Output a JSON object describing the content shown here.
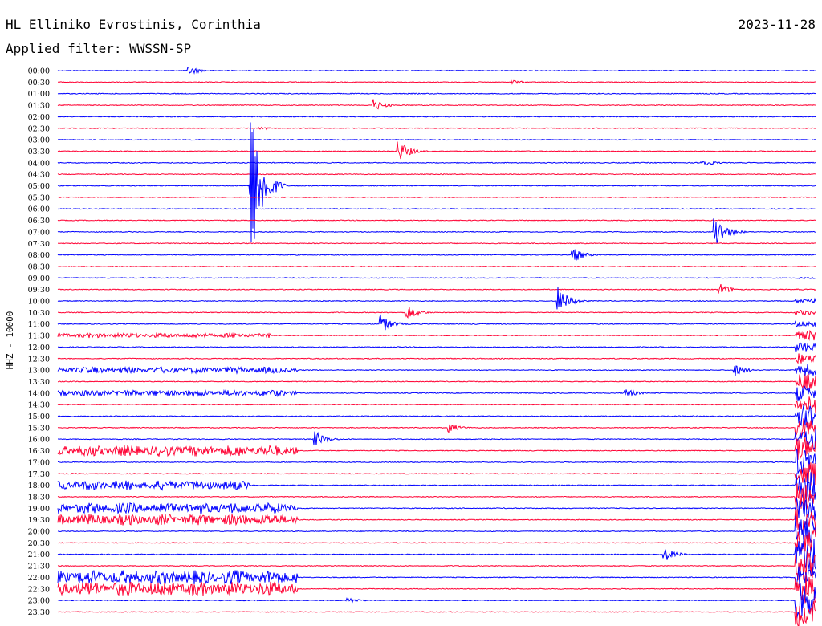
{
  "header": {
    "station": "HL Elliniko Evrostinis, Corinthia",
    "date": "2023-11-28",
    "filter": "Applied filter: WWSSN-SP"
  },
  "colors": {
    "even_trace": "#0000ff",
    "odd_trace": "#ff0033",
    "background": "#ffffff"
  },
  "chart_data": {
    "type": "line",
    "title": "HL Elliniko Evrostinis, Corinthia",
    "subtitle": "Applied filter: WWSSN-SP",
    "ylabel": "HHZ - 10000",
    "xlabel": "",
    "grid": false,
    "legend": "none",
    "row_labels": [
      "00:00",
      "00:30",
      "01:00",
      "01:30",
      "02:00",
      "02:30",
      "03:00",
      "03:30",
      "04:00",
      "04:30",
      "05:00",
      "05:30",
      "06:00",
      "06:30",
      "07:00",
      "07:30",
      "08:00",
      "08:30",
      "09:00",
      "09:30",
      "10:00",
      "10:30",
      "11:00",
      "11:30",
      "12:00",
      "12:30",
      "13:00",
      "13:30",
      "14:00",
      "14:30",
      "15:00",
      "15:30",
      "16:00",
      "16:30",
      "17:00",
      "17:30",
      "18:00",
      "18:30",
      "19:00",
      "19:30",
      "20:00",
      "20:30",
      "21:00",
      "21:30",
      "22:00",
      "22:30",
      "23:00",
      "23:30"
    ],
    "x_range_minutes": [
      0,
      30
    ],
    "noise_level": [
      1,
      1,
      1,
      1,
      1,
      1,
      1,
      1,
      1,
      1,
      1,
      1,
      1,
      1,
      1,
      1,
      1,
      1,
      1,
      1,
      1,
      1,
      1,
      3,
      1,
      1,
      4,
      1,
      4,
      1,
      1,
      1,
      1,
      7,
      1,
      1,
      6,
      1,
      7,
      7,
      1,
      1,
      1,
      1,
      9,
      9,
      1,
      1
    ],
    "noise_end_minute": [
      30,
      30,
      30,
      30,
      30,
      30,
      30,
      30,
      30,
      30,
      30,
      30,
      30,
      30,
      30,
      30,
      30,
      30,
      30,
      30,
      30,
      30,
      30,
      8.4,
      30,
      30,
      9.5,
      30,
      9.5,
      30,
      30,
      30,
      30,
      9.5,
      30,
      30,
      7.6,
      30,
      9.5,
      9.5,
      30,
      30,
      30,
      30,
      9.5,
      9.5,
      30,
      30
    ],
    "late_activity_start_minute": 29.2,
    "late_activity_level": [
      0,
      0,
      0,
      0,
      0,
      0,
      0,
      0,
      0,
      0,
      0,
      0,
      0,
      0,
      0,
      0,
      0,
      0,
      1,
      1,
      3,
      3,
      5,
      6,
      6,
      8,
      8,
      10,
      12,
      12,
      14,
      16,
      16,
      18,
      18,
      18,
      20,
      20,
      20,
      20,
      20,
      20,
      20,
      20,
      20,
      20,
      22,
      22
    ],
    "events": [
      {
        "row": 0,
        "minute": 5.2,
        "amplitude": 6
      },
      {
        "row": 1,
        "minute": 18.0,
        "amplitude": 3
      },
      {
        "row": 3,
        "minute": 12.5,
        "amplitude": 8
      },
      {
        "row": 5,
        "minute": 8.0,
        "amplitude": 3
      },
      {
        "row": 7,
        "minute": 13.5,
        "amplitude": 14
      },
      {
        "row": 8,
        "minute": 25.5,
        "amplitude": 6
      },
      {
        "row": 10,
        "minute": 7.6,
        "amplitude": 120
      },
      {
        "row": 12,
        "minute": 41.8,
        "amplitude": 60
      },
      {
        "row": 14,
        "minute": 26.0,
        "amplitude": 24
      },
      {
        "row": 16,
        "minute": 20.4,
        "amplitude": 10
      },
      {
        "row": 19,
        "minute": 26.2,
        "amplitude": 8
      },
      {
        "row": 20,
        "minute": 19.8,
        "amplitude": 18
      },
      {
        "row": 21,
        "minute": 13.8,
        "amplitude": 10
      },
      {
        "row": 22,
        "minute": 12.8,
        "amplitude": 12
      },
      {
        "row": 26,
        "minute": 26.8,
        "amplitude": 8
      },
      {
        "row": 28,
        "minute": 22.5,
        "amplitude": 6
      },
      {
        "row": 31,
        "minute": 15.5,
        "amplitude": 6
      },
      {
        "row": 32,
        "minute": 10.2,
        "amplitude": 10
      },
      {
        "row": 42,
        "minute": 24.0,
        "amplitude": 10
      },
      {
        "row": 46,
        "minute": 11.5,
        "amplitude": 4
      }
    ]
  }
}
